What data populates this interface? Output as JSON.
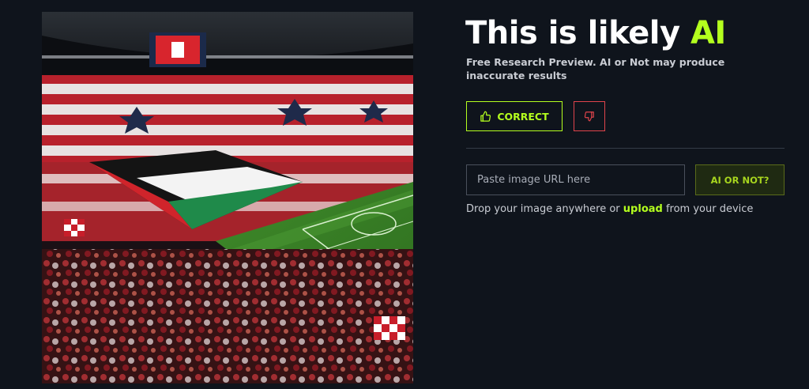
{
  "result": {
    "headline_prefix": "This is likely",
    "headline_verdict": "AI",
    "disclaimer": "Free Research Preview. AI or Not may produce inaccurate results"
  },
  "feedback": {
    "correct_label": "CORRECT",
    "correct_icon": "thumbs-up-icon",
    "wrong_icon": "thumbs-down-icon"
  },
  "url_form": {
    "placeholder": "Paste image URL here",
    "value": "",
    "submit_label": "AI OR NOT?"
  },
  "drop_hint": {
    "before": "Drop your image anywhere or",
    "link": "upload",
    "after": "from your device"
  },
  "colors": {
    "background": "#0f141c",
    "accent": "#b4ff1e",
    "danger": "#e0444b",
    "text_muted": "#c9ccd3"
  }
}
